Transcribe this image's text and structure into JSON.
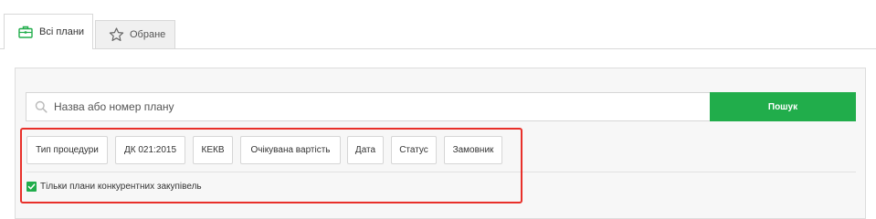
{
  "tabs": [
    {
      "label": "Всі плани",
      "icon": "briefcase-icon",
      "active": true
    },
    {
      "label": "Обране",
      "icon": "star-icon",
      "active": false
    }
  ],
  "search": {
    "placeholder": "Назва або номер плану",
    "value": "",
    "button_label": "Пошук"
  },
  "filters": [
    {
      "label": "Тип процедури"
    },
    {
      "label": "ДК 021:2015"
    },
    {
      "label": "КЕКВ"
    },
    {
      "label": "Очікувана вартість"
    },
    {
      "label": "Дата"
    },
    {
      "label": "Статус"
    },
    {
      "label": "Замовник"
    }
  ],
  "competitive_only": {
    "label": "Тільки плани конкурентних закупівель",
    "checked": true
  },
  "colors": {
    "accent": "#21ad4b",
    "highlight": "#e8302a"
  }
}
